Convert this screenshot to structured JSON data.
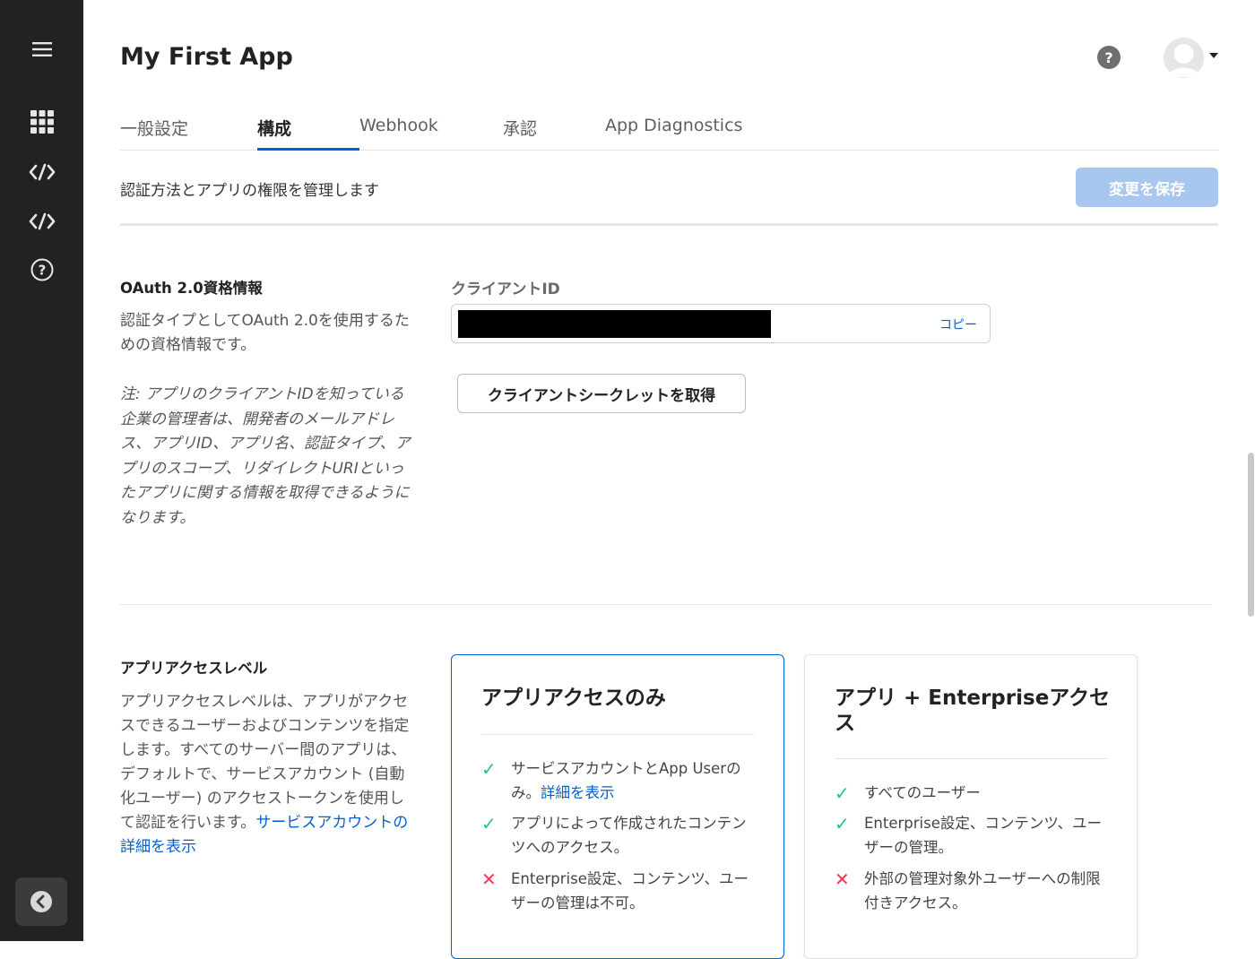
{
  "sidebar": {
    "icons": [
      "menu-icon",
      "apps-grid-icon",
      "code-icon",
      "code-icon",
      "help-circle-icon"
    ],
    "collapse_icon": "chevron-left-icon"
  },
  "header": {
    "title": "My First App",
    "help_glyph": "?"
  },
  "tabs": [
    {
      "label": "一般設定",
      "active": false
    },
    {
      "label": "構成",
      "active": true
    },
    {
      "label": "Webhook",
      "active": false
    },
    {
      "label": "承認",
      "active": false
    },
    {
      "label": "App Diagnostics",
      "active": false
    }
  ],
  "subheader": {
    "text": "認証方法とアプリの権限を管理します",
    "save_label": "変更を保存"
  },
  "oauth": {
    "title": "OAuth 2.0資格情報",
    "desc": "認証タイプとしてOAuth 2.0を使用するための資格情報です。",
    "note": "注: アプリのクライアントIDを知っている企業の管理者は、開発者のメールアドレス、アプリID、アプリ名、認証タイプ、アプリのスコープ、リダイレクトURIといったアプリに関する情報を取得できるようになります。",
    "client_id_label": "クライアントID",
    "copy_label": "コピー",
    "secret_button": "クライアントシークレットを取得"
  },
  "access": {
    "title": "アプリアクセスレベル",
    "desc": "アプリアクセスレベルは、アプリがアクセスできるユーザーおよびコンテンツを指定します。すべてのサーバー間のアプリは、デフォルトで、サービスアカウント (自動化ユーザー) のアクセストークンを使用して認証を行います。",
    "desc_link": "サービスアカウントの詳細を表示",
    "cards": [
      {
        "title": "アプリアクセスのみ",
        "selected": true,
        "features": [
          {
            "ok": true,
            "text": "サービスアカウントとApp Userのみ。",
            "link": "詳細を表示"
          },
          {
            "ok": true,
            "text": "アプリによって作成されたコンテンツへのアクセス。",
            "link": ""
          },
          {
            "ok": false,
            "text": "Enterprise設定、コンテンツ、ユーザーの管理は不可。",
            "link": ""
          }
        ]
      },
      {
        "title": "アプリ + Enterpriseアクセス",
        "selected": false,
        "features": [
          {
            "ok": true,
            "text": "すべてのユーザー",
            "link": ""
          },
          {
            "ok": true,
            "text": "Enterprise設定、コンテンツ、ユーザーの管理。",
            "link": ""
          },
          {
            "ok": false,
            "text": "外部の管理対象外ユーザーへの制限付きアクセス。",
            "link": ""
          }
        ]
      }
    ]
  },
  "colors": {
    "accent": "#0061d5",
    "sidebar": "#222222",
    "check": "#26c281",
    "cross": "#ed3757",
    "save_disabled": "#a7c7ef"
  }
}
